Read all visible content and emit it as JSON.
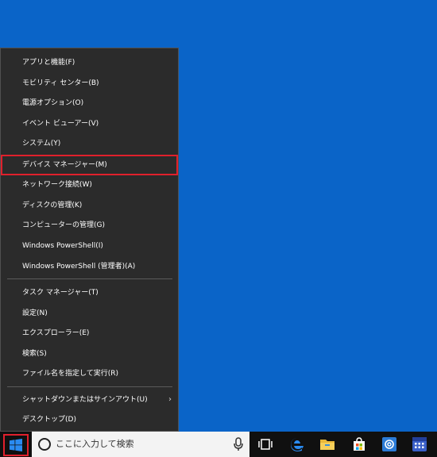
{
  "menu": {
    "items": [
      {
        "label": "アプリと機能(F)"
      },
      {
        "label": "モビリティ センター(B)"
      },
      {
        "label": "電源オプション(O)"
      },
      {
        "label": "イベント ビューアー(V)"
      },
      {
        "label": "システム(Y)"
      },
      {
        "label": "デバイス マネージャー(M)"
      },
      {
        "label": "ネットワーク接続(W)"
      },
      {
        "label": "ディスクの管理(K)"
      },
      {
        "label": "コンピューターの管理(G)"
      },
      {
        "label": "Windows PowerShell(I)"
      },
      {
        "label": "Windows PowerShell (管理者)(A)"
      },
      {
        "label": "タスク マネージャー(T)"
      },
      {
        "label": "設定(N)"
      },
      {
        "label": "エクスプローラー(E)"
      },
      {
        "label": "検索(S)"
      },
      {
        "label": "ファイル名を指定して実行(R)"
      },
      {
        "label": "シャットダウンまたはサインアウト(U)"
      },
      {
        "label": "デスクトップ(D)"
      }
    ],
    "highlighted_item": "デバイス マネージャー(M)",
    "submenu_arrow": "›"
  },
  "taskbar": {
    "search_placeholder": "ここに入力して検索",
    "icons": [
      "windows-logo-icon",
      "microphone-icon",
      "task-view-icon",
      "edge-icon",
      "file-explorer-icon",
      "store-icon",
      "mail-icon",
      "calendar-icon"
    ]
  },
  "colors": {
    "desktop": "#0a64c8",
    "menu_bg": "#2b2b2b",
    "highlight_border": "#e0202c",
    "taskbar": "#101010"
  }
}
